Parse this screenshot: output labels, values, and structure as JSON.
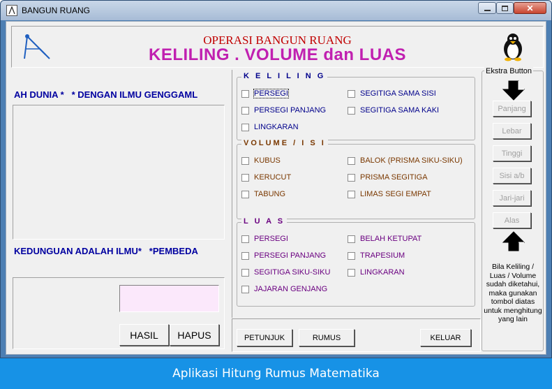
{
  "window": {
    "title": "BANGUN RUANG"
  },
  "header": {
    "subtitle": "OPERASI BANGUN RUANG",
    "title": "KELILING . VOLUME dan LUAS",
    "left_icon": "compass-icon",
    "right_icon": "penguin-icon"
  },
  "left": {
    "marquee_top": "AH DUNIA *   * DENGAN ILMU GENGGAML",
    "marquee_bottom": "KEDUNGUAN ADALAH ILMU*   *PEMBEDA",
    "result_value": "",
    "hasil_label": "HASIL",
    "hapus_label": "HAPUS"
  },
  "groups": {
    "keliling": {
      "label": "K E L I L I N G",
      "items": [
        "PERSEGI",
        "SEGITIGA SAMA SISI",
        "PERSEGI PANJANG",
        "SEGITIGA SAMA KAKI",
        "LINGKARAN"
      ]
    },
    "volume": {
      "label": "VOLUME / I S I",
      "items": [
        "KUBUS",
        "BALOK (PRISMA SIKU-SIKU)",
        "KERUCUT",
        "PRISMA SEGITIGA",
        "TABUNG",
        "LIMAS SEGI EMPAT"
      ]
    },
    "luas": {
      "label": "L U A S",
      "items": [
        "PERSEGI",
        "BELAH KETUPAT",
        "PERSEGI PANJANG",
        "TRAPESIUM",
        "SEGITIGA SIKU-SIKU",
        "LINGKARAN",
        "JAJARAN GENJANG"
      ]
    }
  },
  "buttons": {
    "petunjuk": "PETUNJUK",
    "rumus": "RUMUS",
    "keluar": "KELUAR"
  },
  "ekstra": {
    "label": "Ekstra Button",
    "buttons": [
      "Panjang",
      "Lebar",
      "Tinggi",
      "Sisi a/b",
      "Jari-jari",
      "Alas"
    ],
    "note": "Bila Keliling / Luas / Volume sudah diketahui, maka gunakan tombol diatas untuk menghitung yang lain"
  },
  "banner": {
    "text": "Aplikasi Hitung Rumus Matematika"
  }
}
